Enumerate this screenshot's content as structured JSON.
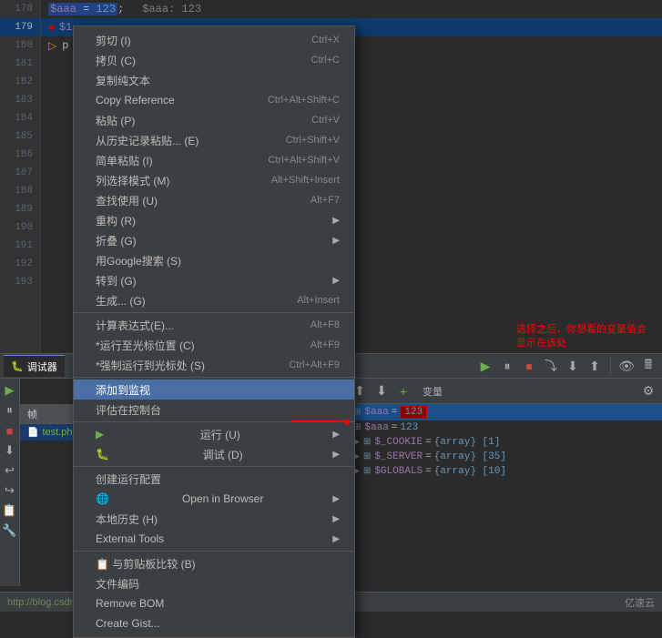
{
  "editor": {
    "lines": [
      {
        "num": "178",
        "code": "$aaa = 123;",
        "comment": "$aaa: 123",
        "active": false,
        "selected": true
      },
      {
        "num": "179",
        "code": "$1",
        "active": true,
        "error": true
      },
      {
        "num": "180",
        "code": "p",
        "active": false
      },
      {
        "num": "181",
        "code": "",
        "active": false
      },
      {
        "num": "182",
        "code": "",
        "active": false
      },
      {
        "num": "183",
        "code": "",
        "active": false
      },
      {
        "num": "184",
        "code": "",
        "active": false
      },
      {
        "num": "185",
        "code": "",
        "active": false
      },
      {
        "num": "186",
        "code": "",
        "active": false
      },
      {
        "num": "187",
        "code": "",
        "active": false
      },
      {
        "num": "188",
        "code": "",
        "active": false
      },
      {
        "num": "189",
        "code": "",
        "active": false
      },
      {
        "num": "190",
        "code": "",
        "active": false
      },
      {
        "num": "191",
        "code": "",
        "active": false
      },
      {
        "num": "192",
        "code": "",
        "active": false
      },
      {
        "num": "193",
        "code": "",
        "active": false
      }
    ]
  },
  "context_menu": {
    "items": [
      {
        "label": "剪切 (I)",
        "shortcut": "Ctrl+X",
        "icon": "✂",
        "separator_after": false,
        "submenu": false
      },
      {
        "label": "拷贝 (C)",
        "shortcut": "Ctrl+C",
        "icon": "⧉",
        "separator_after": false,
        "submenu": false
      },
      {
        "label": "复制纯文本",
        "shortcut": "",
        "icon": "",
        "separator_after": false,
        "submenu": false
      },
      {
        "label": "Copy Reference",
        "shortcut": "Ctrl+Alt+Shift+C",
        "icon": "",
        "separator_after": false,
        "submenu": false
      },
      {
        "label": "粘贴 (P)",
        "shortcut": "Ctrl+V",
        "icon": "📋",
        "separator_after": false,
        "submenu": false
      },
      {
        "label": "从历史记录粘贴... (E)",
        "shortcut": "Ctrl+Shift+V",
        "icon": "",
        "separator_after": false,
        "submenu": false
      },
      {
        "label": "简单粘贴 (I)",
        "shortcut": "Ctrl+Alt+Shift+V",
        "icon": "",
        "separator_after": false,
        "submenu": false
      },
      {
        "label": "列选择模式 (M)",
        "shortcut": "Alt+Shift+Insert",
        "icon": "",
        "separator_after": false,
        "submenu": false
      },
      {
        "label": "查找使用 (U)",
        "shortcut": "Alt+F7",
        "icon": "",
        "separator_after": false,
        "submenu": false
      },
      {
        "label": "重构 (R)",
        "shortcut": "",
        "icon": "",
        "separator_after": false,
        "submenu": true
      },
      {
        "label": "折叠 (G)",
        "shortcut": "",
        "icon": "",
        "separator_after": false,
        "submenu": true
      },
      {
        "label": "用Google搜索 (S)",
        "shortcut": "",
        "icon": "",
        "separator_after": false,
        "submenu": false
      },
      {
        "label": "转到 (G)",
        "shortcut": "",
        "icon": "",
        "separator_after": false,
        "submenu": true
      },
      {
        "label": "生成... (G)",
        "shortcut": "Alt+Insert",
        "icon": "",
        "separator_after": false,
        "submenu": false
      },
      {
        "label": "计算表达式(E)...",
        "shortcut": "Alt+F8",
        "icon": "🖩",
        "separator_after": false,
        "submenu": false
      },
      {
        "label": "运行至光标位置 (C)",
        "shortcut": "Alt+F9",
        "icon": "▶",
        "separator_after": false,
        "submenu": false
      },
      {
        "label": "强制运行到光标处 (S)",
        "shortcut": "Ctrl+Alt+F9",
        "icon": "▶▶",
        "separator_after": true,
        "submenu": false
      },
      {
        "label": "添加到监视",
        "shortcut": "",
        "icon": "",
        "separator_after": false,
        "submenu": false,
        "highlighted": true
      },
      {
        "label": "评估在控制台",
        "shortcut": "",
        "icon": "",
        "separator_after": true,
        "submenu": false
      },
      {
        "label": "运行 (U)",
        "shortcut": "",
        "icon": "▶",
        "separator_after": false,
        "submenu": true
      },
      {
        "label": "调试 (D)",
        "shortcut": "",
        "icon": "🐛",
        "separator_after": true,
        "submenu": true
      },
      {
        "label": "创建运行配置",
        "shortcut": "",
        "icon": "",
        "separator_after": false,
        "submenu": false
      },
      {
        "label": "Open in Browser",
        "shortcut": "",
        "icon": "🌐",
        "separator_after": false,
        "submenu": true
      },
      {
        "label": "本地历史 (H)",
        "shortcut": "",
        "icon": "",
        "separator_after": false,
        "submenu": true
      },
      {
        "label": "External Tools",
        "shortcut": "",
        "icon": "",
        "separator_after": true,
        "submenu": true
      },
      {
        "label": "与剪贴板比较 (B)",
        "shortcut": "",
        "icon": "📋",
        "separator_after": false,
        "submenu": false
      },
      {
        "label": "文件编码",
        "shortcut": "",
        "icon": "",
        "separator_after": false,
        "submenu": false
      },
      {
        "label": "Remove BOM",
        "shortcut": "",
        "icon": "",
        "separator_after": false,
        "submenu": false
      },
      {
        "label": "Create Gist...",
        "shortcut": "",
        "icon": "",
        "separator_after": false,
        "submenu": false
      }
    ]
  },
  "debug_tabs": [
    {
      "label": "调试",
      "icon": "🐛",
      "active": true
    },
    {
      "label": "test.php",
      "icon": "📄",
      "active": false
    }
  ],
  "debug_toolbar_btns": [
    "▶",
    "⏸",
    "⏹",
    "⏭",
    "⏬",
    "⬆"
  ],
  "frames": {
    "header": "帧",
    "items": [
      {
        "label": "test.php",
        "active": true,
        "icon": "📄"
      }
    ]
  },
  "vars": {
    "header": "变量",
    "items": [
      {
        "name": "$aaa",
        "eq": "=",
        "val": "123",
        "highlighted": true,
        "redbox": true,
        "level": 0
      },
      {
        "name": "$aaa",
        "eq": "=",
        "val": "123",
        "highlighted": false,
        "redbox": false,
        "level": 0
      },
      {
        "name": "$_COOKIE",
        "eq": "=",
        "val": "{array} [1]",
        "highlighted": false,
        "redbox": false,
        "level": 0,
        "expandable": true
      },
      {
        "name": "$_SERVER",
        "eq": "=",
        "val": "{array} [35]",
        "highlighted": false,
        "redbox": false,
        "level": 0,
        "expandable": true
      },
      {
        "name": "$GLOBALS",
        "eq": "=",
        "val": "{array} [10]",
        "highlighted": false,
        "redbox": false,
        "level": 0,
        "expandable": true
      }
    ]
  },
  "callout": {
    "text": "选择之后，你想看的变量值会显示在该处"
  },
  "status_bar": {
    "url": "http://blog.csdn.net/qq",
    "right_label": "亿速云"
  }
}
